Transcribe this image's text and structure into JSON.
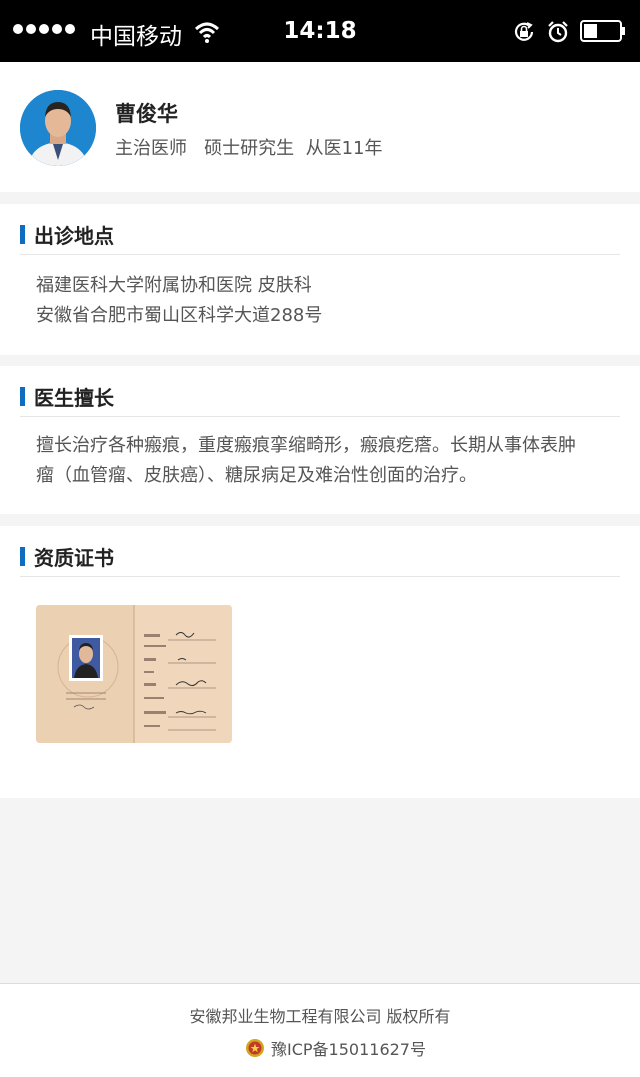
{
  "status_bar": {
    "carrier": "中国移动",
    "time": "14:18"
  },
  "doctor": {
    "name": "曹俊华",
    "meta": "主治医师   硕士研究生  从医11年"
  },
  "clinic": {
    "title": "出诊地点",
    "hospital": "福建医科大学附属协和医院  皮肤科",
    "address": "安徽省合肥市蜀山区科学大道288号"
  },
  "specialty": {
    "title": "医生擅长",
    "line1": "擅长治疗各种瘢痕，重度瘢痕挛缩畸形，瘢痕疙瘩。长期从事体表肿",
    "line2": "瘤（血管瘤、皮肤癌）、糖尿病足及难治性创面的治疗。"
  },
  "certificate": {
    "title": "资质证书"
  },
  "footer": {
    "copyright": "安徽邦业生物工程有限公司 版权所有",
    "icp": "豫ICP备15011627号"
  },
  "colors": {
    "accent": "#0f6cc0",
    "status_bar": "#000000",
    "background": "#f4f4f4"
  }
}
